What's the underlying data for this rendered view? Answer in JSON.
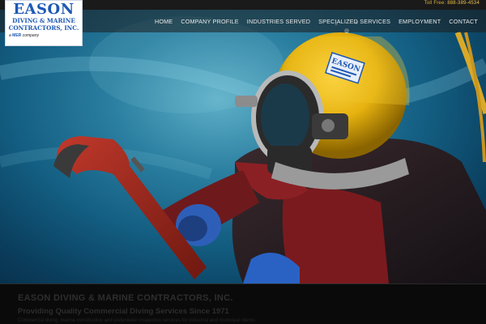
{
  "topbar": {
    "toll_free_label": "Toll Free: ",
    "toll_free_number": "888-389-4534"
  },
  "logo": {
    "line1": "EASON",
    "line2": "DIVING & MARINE",
    "line3": "CONTRACTORS, INC.",
    "tagline_prefix": "a",
    "tagline_brand": "MER",
    "tagline_suffix": "company"
  },
  "nav": {
    "items": [
      {
        "label": "HOME"
      },
      {
        "label": "COMPANY PROFILE"
      },
      {
        "label": "INDUSTRIES SERVED"
      },
      {
        "label": "SPECIALIZED SERVICES"
      },
      {
        "label": "EMPLOYMENT"
      },
      {
        "label": "CONTACT"
      }
    ]
  },
  "hero": {
    "helmet_label": "EASON"
  },
  "band": {
    "heading": "EASON DIVING & MARINE CONTRACTORS, INC.",
    "subheading": "Providing Quality Commercial Diving Services Since 1971",
    "detail": "Commercial diving, marine construction and underwater inspection services for industrial and municipal clients"
  },
  "colors": {
    "accent_gold": "#e0b23a",
    "brand_blue": "#1d58b5"
  }
}
